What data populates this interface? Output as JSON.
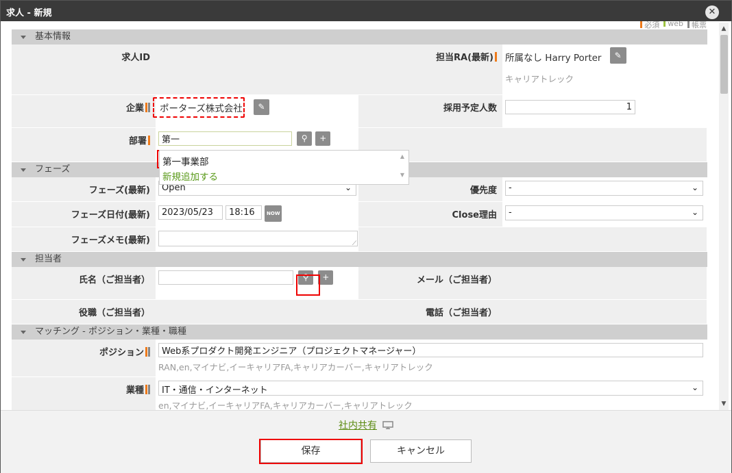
{
  "dialog": {
    "title": "求人 - 新規"
  },
  "legend": {
    "required": "必須",
    "web": "web",
    "document": "帳票",
    "colors": {
      "required": "#ee7a1a",
      "web": "#9dc241",
      "document": "#888888"
    }
  },
  "sections": {
    "basic": "基本情報",
    "phase": "フェーズ",
    "person": "担当者",
    "matching": "マッチング - ポジション・業種・職種"
  },
  "basic": {
    "job_id_label": "求人ID",
    "ra_label": "担当RA(最新)",
    "ra_value": "所属なし Harry Porter",
    "ra_sub": "キャリアトレック",
    "company_label": "企業",
    "company_value": "ポーターズ株式会社",
    "hires_label": "採用予定人数",
    "hires_value": "1",
    "dept_label": "部署",
    "dept_value": "第一"
  },
  "dept_dropdown": {
    "option1": "第一事業部",
    "option2": "新規追加する"
  },
  "phase": {
    "phase_label": "フェーズ(最新)",
    "phase_value": "Open",
    "priority_label": "優先度",
    "priority_value": "-",
    "date_label": "フェーズ日付(最新)",
    "date_value": "2023/05/23",
    "time_value": "18:16",
    "now_label": "NOW",
    "close_label": "Close理由",
    "close_value": "-",
    "memo_label": "フェーズメモ(最新)"
  },
  "person": {
    "name_label": "氏名（ご担当者）",
    "mail_label": "メール（ご担当者）",
    "title_label": "役職（ご担当者）",
    "phone_label": "電話（ご担当者）"
  },
  "matching": {
    "position_label": "ポジション",
    "position_value": "Web系プロダクト開発エンジニア（プロジェクトマネージャー）",
    "position_sub": "RAN,en,マイナビ,イーキャリアFA,キャリアカーバー,キャリアトレック",
    "industry_label": "業種",
    "industry_value": "IT・通信・インターネット",
    "industry_sub": "en,マイナビ,イーキャリアFA,キャリアカーバー,キャリアトレック"
  },
  "footer": {
    "share_label": "社内共有",
    "save_label": "保存",
    "cancel_label": "キャンセル"
  },
  "icons": {
    "close": "close-icon",
    "edit": "pencil-icon",
    "search": "search-icon",
    "add": "plus-icon",
    "chevron": "chevron-down-icon",
    "monitor": "monitor-icon"
  }
}
